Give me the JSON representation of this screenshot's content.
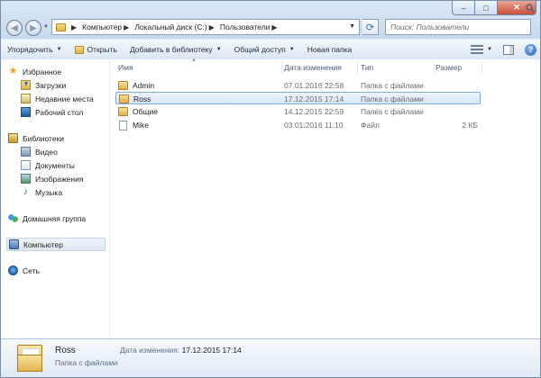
{
  "window": {
    "minimize": "–",
    "maximize": "□",
    "close": "✕"
  },
  "address": {
    "crumbs": [
      {
        "label": "Компьютер"
      },
      {
        "label": "Локальный диск (C:)"
      },
      {
        "label": "Пользователи"
      }
    ],
    "search_placeholder": "Поиск: Пользователи"
  },
  "commands": [
    {
      "label": "Упорядочить",
      "dropdown": true
    },
    {
      "label": "Открыть",
      "dropdown": false,
      "icon": "open-folder-icon"
    },
    {
      "label": "Добавить в библиотеку",
      "dropdown": true
    },
    {
      "label": "Общий доступ",
      "dropdown": true
    },
    {
      "label": "Новая папка",
      "dropdown": false
    }
  ],
  "nav": {
    "favorites": "Избранное",
    "downloads": "Загрузки",
    "recent": "Недавние места",
    "desktop": "Рабочий стол",
    "libraries": "Библиотеки",
    "video": "Видео",
    "documents": "Документы",
    "images": "Изображения",
    "music": "Музыка",
    "homegroup": "Домашняя группа",
    "computer": "Компьютер",
    "network": "Сеть"
  },
  "columns": {
    "name": "Имя",
    "date": "Дата изменения",
    "type": "Тип",
    "size": "Размер"
  },
  "files": [
    {
      "name": "Admin",
      "date": "07.01.2016 22:58",
      "type": "Папка с файлами",
      "size": "",
      "icon": "folder-icon"
    },
    {
      "name": "Ross",
      "date": "17.12.2015 17:14",
      "type": "Папка с файлами",
      "size": "",
      "icon": "folder-icon",
      "selected": true
    },
    {
      "name": "Общие",
      "date": "14.12.2015 22:59",
      "type": "Папка с файлами",
      "size": "",
      "icon": "folder-icon"
    },
    {
      "name": "Mike",
      "date": "03.01.2016 11:10",
      "type": "Файл",
      "size": "2 КБ",
      "icon": "file-icon"
    }
  ],
  "details": {
    "name": "Ross",
    "type": "Папка с файлами",
    "modified_label": "Дата изменения:",
    "modified_value": "17.12.2015 17:14"
  }
}
